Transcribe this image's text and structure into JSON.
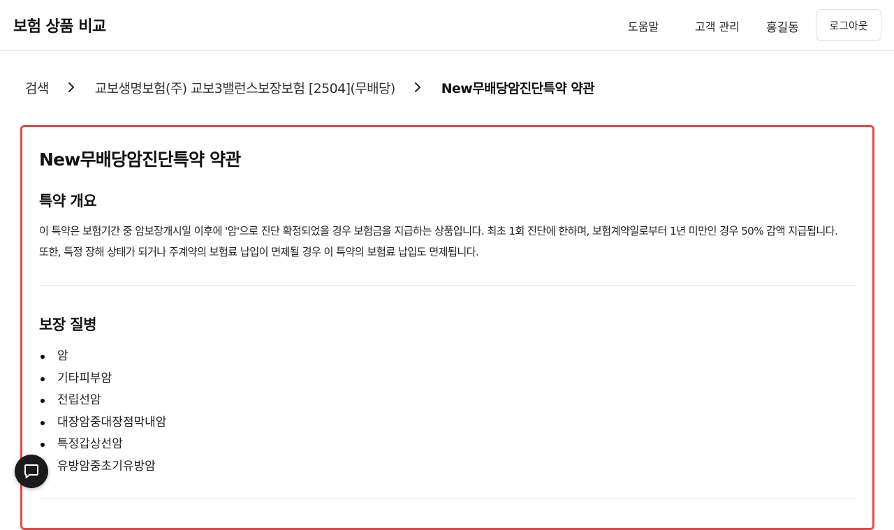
{
  "header": {
    "app_title": "보험 상품 비교",
    "nav": {
      "help": "도움말",
      "customer_mgmt": "고객 관리"
    },
    "user_name": "홍길동",
    "logout_label": "로그아웃"
  },
  "breadcrumb": {
    "items": [
      "검색",
      "교보생명보험(주) 교보3밸런스보장보험 [2504](무배당)",
      "New무배당암진단특약 약관"
    ]
  },
  "terms": {
    "title": "New무배당암진단특약 약관",
    "overview": {
      "heading": "특약 개요",
      "text": "이 특약은 보험기간 중 암보장개시일 이후에 '암'으로 진단 확정되었을 경우 보험금을 지급하는 상품입니다. 최초 1회 진단에 한하며, 보험계약일로부터 1년 미만인 경우 50% 감액 지급됩니다. 또한, 특정 장해 상태가 되거나 주계약의 보험료 납입이 면제될 경우 이 특약의 보험료 납입도 면제됩니다."
    },
    "diseases": {
      "heading": "보장 질병",
      "items": [
        "암",
        "기타피부암",
        "전립선암",
        "대장암중대장점막내암",
        "특정갑상선암",
        "유방암중초기유방암"
      ]
    }
  },
  "icons": {
    "breadcrumb_separator": "chevron-right-icon",
    "chat": "chat-bubble-icon"
  },
  "colors": {
    "card_border": "#e5484d",
    "chat_button": "#1b1b1b"
  }
}
